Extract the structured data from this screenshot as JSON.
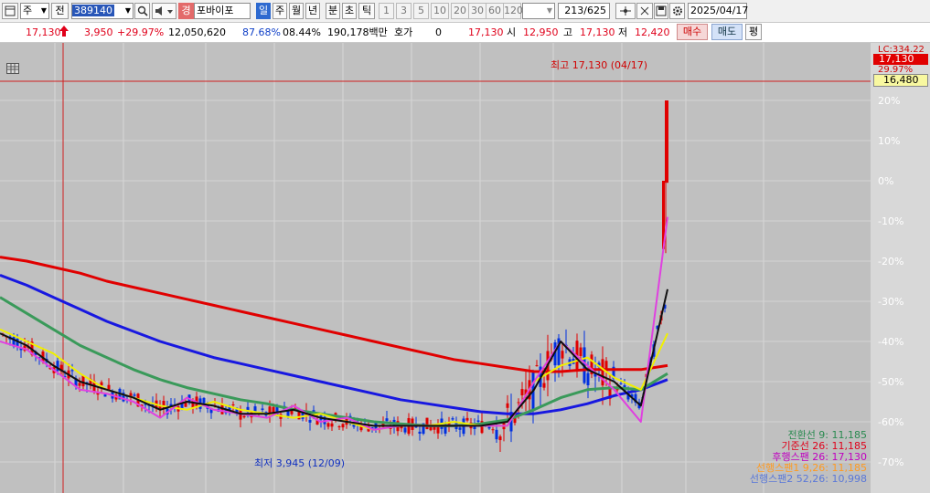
{
  "toolbar": {
    "type_label": "주",
    "jeon_label": "전",
    "code": "389140",
    "name_badge": "경",
    "name": "포바이포",
    "period_tabs": [
      "일",
      "주",
      "월",
      "년",
      "분",
      "초",
      "틱"
    ],
    "intervals": [
      "1",
      "3",
      "5",
      "10",
      "20",
      "30",
      "60",
      "120"
    ],
    "count": "213/625",
    "date": "2025/04/17"
  },
  "quote": {
    "price": "17,130",
    "change": "3,950",
    "change_pct": "+29.97%",
    "volume": "12,050,620",
    "ratio": "87.68%",
    "turnover": "08.44%",
    "amount": "190,178백만",
    "hoga_label": "호가",
    "hoga_value": "0",
    "hoga_price": "17,130",
    "open_label": "시",
    "open": "12,950",
    "high_label": "고",
    "high": "17,130",
    "low_label": "저",
    "low": "12,420",
    "buy_label": "매수",
    "sell_label": "매도",
    "avg_label": "평"
  },
  "chart_data": {
    "type": "line",
    "title": "",
    "y_axis_ticks": [
      "20%",
      "10%",
      "0%",
      "-10%",
      "-20%",
      "-30%",
      "-40%",
      "-50%",
      "-60%",
      "-70%"
    ],
    "y_axis_unit": "% from reference 16,480",
    "reference_price": "16,480",
    "current_price_tag": "17,130",
    "axis_top_labels": [
      "LC:334.22",
      "29.97%"
    ],
    "annotations": {
      "high": "최고 17,130 (04/17)",
      "low": "최저 3,945 (12/09)"
    },
    "legend": [
      {
        "text": "전환선 9: 11,185",
        "color": "#3a9a5a"
      },
      {
        "text": "기준선 26: 11,185",
        "color": "#e0001a"
      },
      {
        "text": "후행스팬 26: 17,130",
        "color": "#c000c0"
      },
      {
        "text": "선행스팬1 9,26: 11,185",
        "color": "#ff9a20"
      },
      {
        "text": "선행스팬2 52,26: 10,998",
        "color": "#5a78d8"
      }
    ],
    "series": [
      {
        "name": "",
        "color": "#e00000",
        "values": [
          -19,
          -20,
          -21.5,
          -23,
          -25,
          -26.5,
          -28,
          -29.5,
          -31,
          -32.5,
          -34,
          -35.5,
          -37,
          -38.5,
          -40,
          -41.5,
          -43,
          -44.5,
          -45.5,
          -46.5,
          -47.5,
          -47.5,
          -47,
          -47,
          -47,
          -46
        ]
      },
      {
        "name": "",
        "color": "#1818e0",
        "values": [
          -23.5,
          -26,
          -29,
          -32,
          -35,
          -37.5,
          -40,
          -42,
          -44,
          -45.5,
          -47,
          -48.5,
          -50,
          -51.5,
          -53,
          -54.5,
          -55.5,
          -56.5,
          -57.5,
          -58,
          -58,
          -57,
          -55.5,
          -53.5,
          -52,
          -49.5
        ]
      },
      {
        "name": "",
        "color": "#3a9a5a",
        "values": [
          -29,
          -33,
          -37,
          -41,
          -44,
          -47,
          -49.5,
          -51.5,
          -53,
          -54.5,
          -55.5,
          -57,
          -58,
          -59,
          -60,
          -60.5,
          -61,
          -61,
          -60.5,
          -59.5,
          -57,
          -54,
          -52,
          -51.5,
          -52,
          -48
        ]
      },
      {
        "name": "",
        "color": "#f0f000",
        "values": [
          -37,
          -40,
          -43,
          -48,
          -52,
          -54,
          -56,
          -57,
          -55,
          -57,
          -58,
          -59,
          -58,
          -60,
          -62,
          -61,
          -61,
          -60,
          -61,
          -61,
          -50,
          -46,
          -44,
          -49,
          -52,
          -38
        ]
      },
      {
        "name": "",
        "color": "#e040e0",
        "values": [
          -40,
          -42,
          -47,
          -52,
          -53,
          -55,
          -59,
          -54,
          -57,
          -58,
          -59,
          -56,
          -60,
          -59,
          -62,
          -61,
          -61,
          -61,
          -61,
          -61,
          -50,
          -40,
          -46,
          -52,
          -60,
          -9
        ]
      },
      {
        "name": "",
        "color": "#101010",
        "values": [
          -38,
          -41,
          -46,
          -50,
          -52,
          -54,
          -57,
          -55,
          -56,
          -58,
          -58,
          -57,
          -59,
          -60,
          -61,
          -61,
          -61,
          -61,
          -61,
          -60,
          -52,
          -40,
          -47,
          -50,
          -56,
          -27
        ]
      }
    ]
  }
}
